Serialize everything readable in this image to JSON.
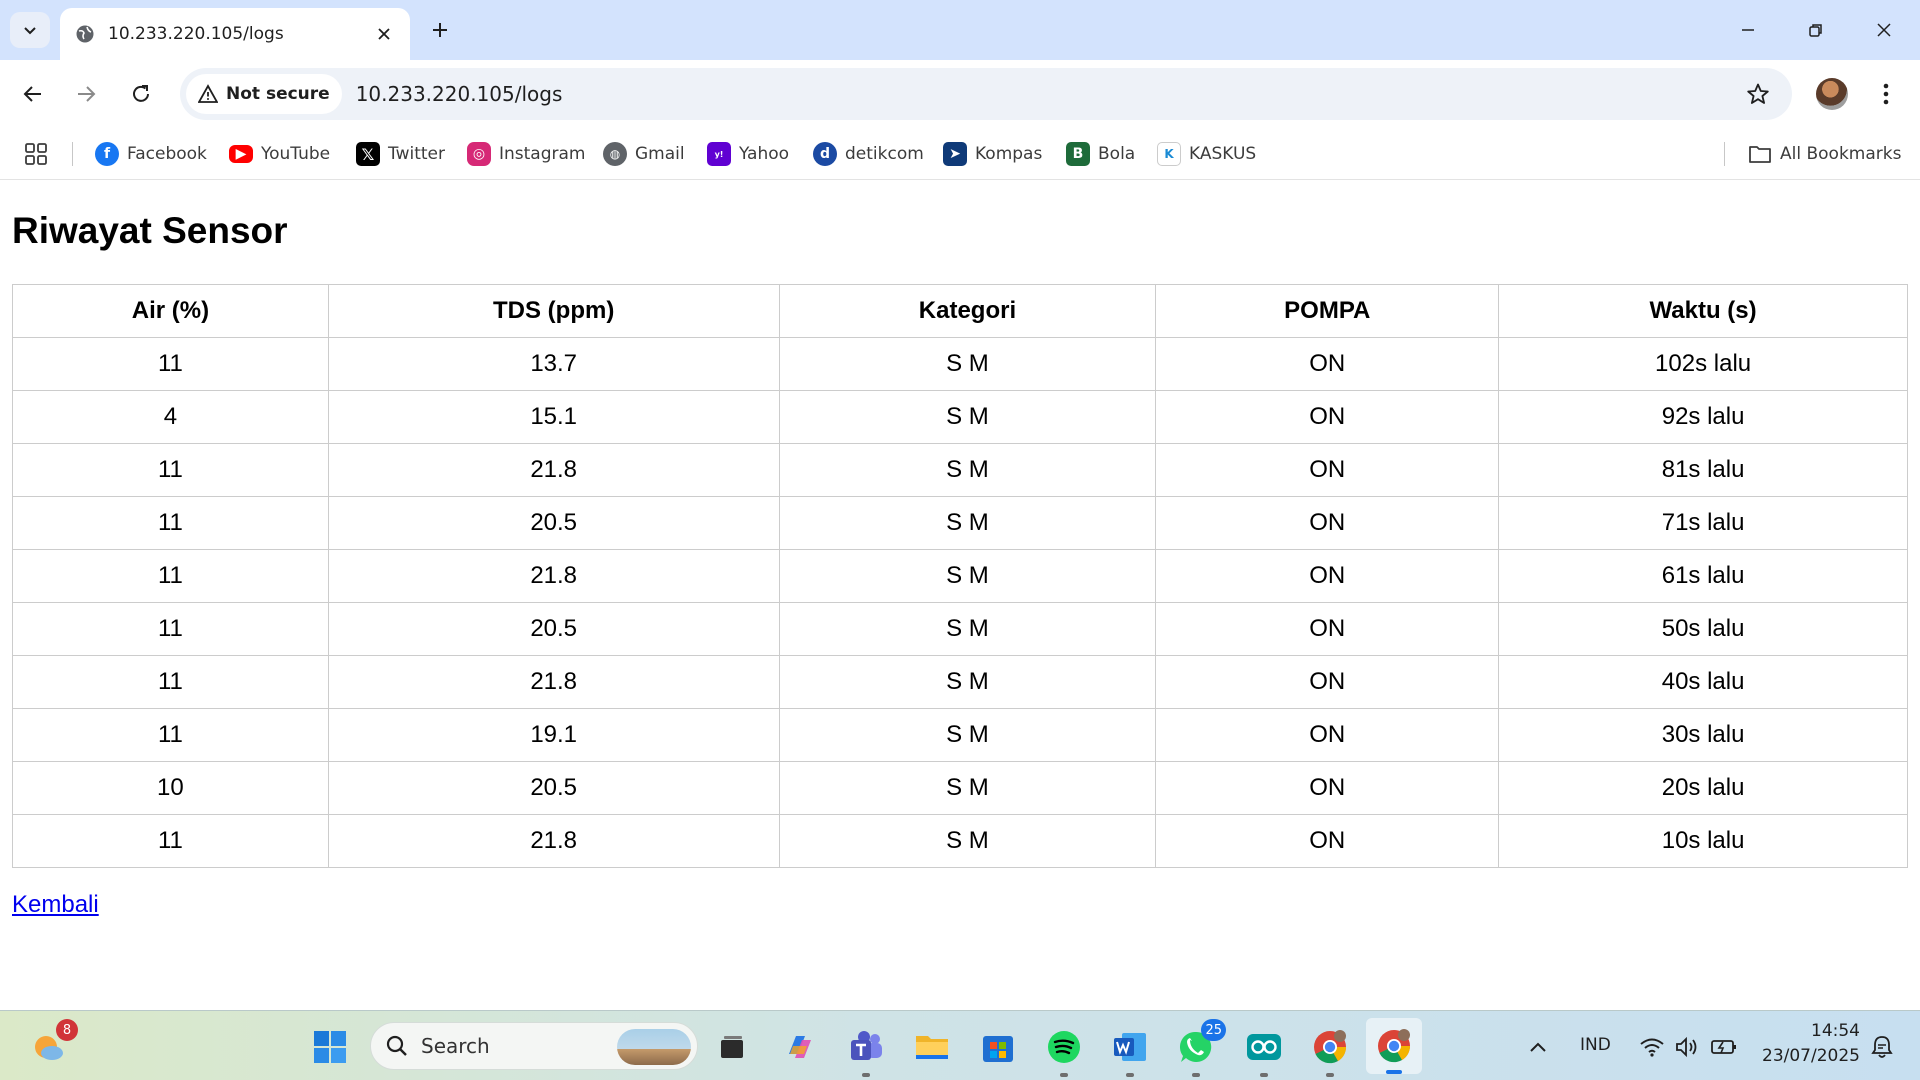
{
  "browser": {
    "tab_title": "10.233.220.105/logs",
    "security_label": "Not secure",
    "url": "10.233.220.105/logs",
    "bookmarks": [
      {
        "label": "Facebook",
        "color": "#1877f2"
      },
      {
        "label": "YouTube",
        "color": "#ff0000"
      },
      {
        "label": "Twitter",
        "color": "#000000"
      },
      {
        "label": "Instagram",
        "color": "#d62976"
      },
      {
        "label": "Gmail",
        "color": "#5f6368"
      },
      {
        "label": "Yahoo",
        "color": "#6001d2"
      },
      {
        "label": "detikcom",
        "color": "#1b4aa3"
      },
      {
        "label": "Kompas",
        "color": "#0f3a78"
      },
      {
        "label": "Bola",
        "color": "#1e6b3a"
      },
      {
        "label": "KASKUS",
        "color": "#1a8ad4"
      }
    ],
    "all_bookmarks_label": "All Bookmarks"
  },
  "page": {
    "title": "Riwayat Sensor",
    "headers": [
      "Air (%)",
      "TDS (ppm)",
      "Kategori",
      "POMPA",
      "Waktu (s)"
    ],
    "rows": [
      [
        "11",
        "13.7",
        "S M",
        "ON",
        "102s lalu"
      ],
      [
        "4",
        "15.1",
        "S M",
        "ON",
        "92s lalu"
      ],
      [
        "11",
        "21.8",
        "S M",
        "ON",
        "81s lalu"
      ],
      [
        "11",
        "20.5",
        "S M",
        "ON",
        "71s lalu"
      ],
      [
        "11",
        "21.8",
        "S M",
        "ON",
        "61s lalu"
      ],
      [
        "11",
        "20.5",
        "S M",
        "ON",
        "50s lalu"
      ],
      [
        "11",
        "21.8",
        "S M",
        "ON",
        "40s lalu"
      ],
      [
        "11",
        "19.1",
        "S M",
        "ON",
        "30s lalu"
      ],
      [
        "10",
        "20.5",
        "S M",
        "ON",
        "20s lalu"
      ],
      [
        "11",
        "21.8",
        "S M",
        "ON",
        "10s lalu"
      ]
    ],
    "back_link": "Kembali"
  },
  "taskbar": {
    "weather_badge": "8",
    "search_placeholder": "Search",
    "whatsapp_badge": "25",
    "language": "IND",
    "time": "14:54",
    "date": "23/07/2025"
  }
}
